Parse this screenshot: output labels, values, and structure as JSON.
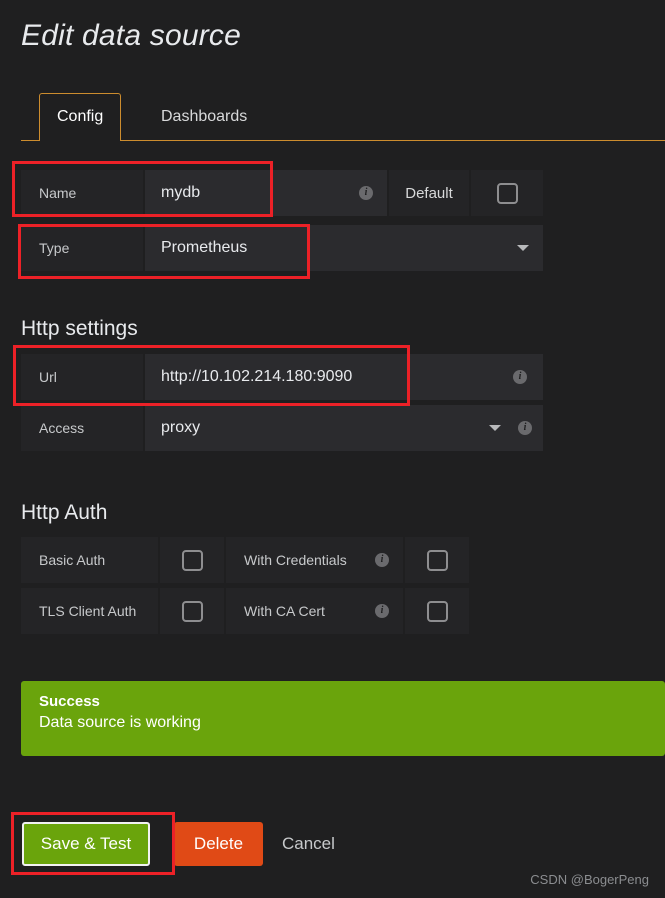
{
  "page": {
    "title": "Edit data source",
    "watermark": "CSDN @BogerPeng"
  },
  "tabs": [
    {
      "label": "Config",
      "active": true
    },
    {
      "label": "Dashboards",
      "active": false
    }
  ],
  "settings": {
    "name": {
      "label": "Name",
      "value": "mydb",
      "info_icon": "info-icon",
      "default_label": "Default",
      "default_checked": false
    },
    "type": {
      "label": "Type",
      "value": "Prometheus",
      "caret_icon": "chevron-down-icon"
    }
  },
  "http_settings": {
    "title": "Http settings",
    "url": {
      "label": "Url",
      "value": "http://10.102.214.180:9090",
      "info_icon": "info-icon"
    },
    "access": {
      "label": "Access",
      "value": "proxy",
      "caret_icon": "chevron-down-icon",
      "info_icon": "info-icon"
    }
  },
  "http_auth": {
    "title": "Http Auth",
    "rows": [
      {
        "left_label": "Basic Auth",
        "left_checked": false,
        "right_label": "With Credentials",
        "right_checked": false,
        "right_info_icon": "info-icon"
      },
      {
        "left_label": "TLS Client Auth",
        "left_checked": false,
        "right_label": "With CA Cert",
        "right_checked": false,
        "right_info_icon": "info-icon"
      }
    ]
  },
  "alert": {
    "title": "Success",
    "message": "Data source is working",
    "color": "#6aa40c"
  },
  "actions": {
    "save": "Save & Test",
    "delete": "Delete",
    "cancel": "Cancel"
  },
  "colors": {
    "accent": "#cc8c2e",
    "success": "#6aa40c",
    "danger": "#e04a16",
    "annotation": "#ec2127",
    "background": "#1f1f20"
  }
}
